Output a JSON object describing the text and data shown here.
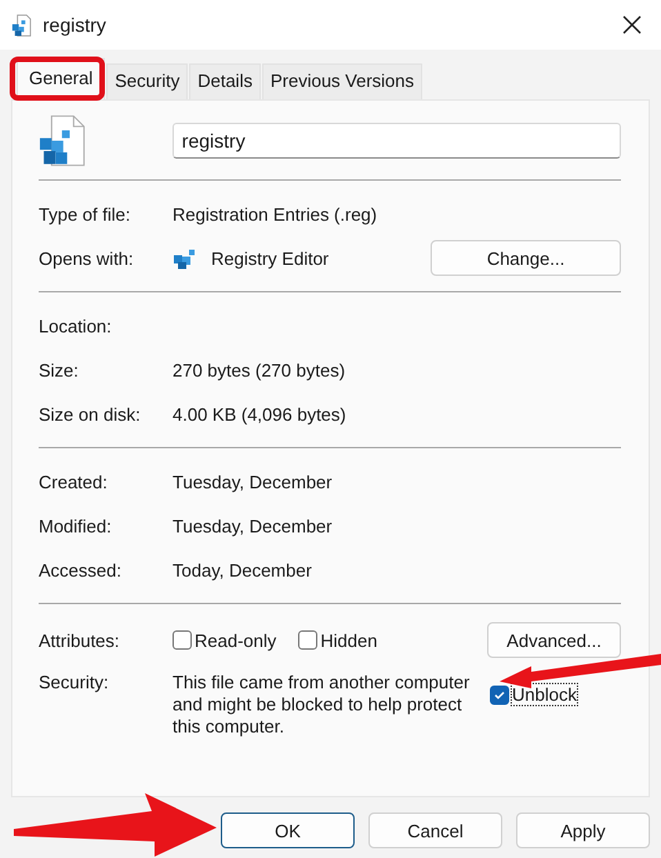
{
  "window": {
    "title": "registry"
  },
  "tabs": [
    {
      "label": "General",
      "selected": true
    },
    {
      "label": "Security",
      "selected": false
    },
    {
      "label": "Details",
      "selected": false
    },
    {
      "label": "Previous Versions",
      "selected": false
    }
  ],
  "file_name": {
    "value": "registry"
  },
  "opens": [
    {
      "label": "Type of file:",
      "value": "Registration Entries (.reg)"
    },
    {
      "label": "Opens with:",
      "value": "Registry Editor",
      "button": "Change..."
    }
  ],
  "location_rows": [
    {
      "label": "Location:"
    },
    {
      "label": "Size:",
      "value": "270 bytes (270 bytes)"
    },
    {
      "label": "Size on disk:",
      "value": "4.00 KB (4,096 bytes)"
    }
  ],
  "date_rows": [
    {
      "label": "Created:",
      "value": "Tuesday, December"
    },
    {
      "label": "Modified:",
      "value": "Tuesday, December"
    },
    {
      "label": "Accessed:",
      "value": "Today, December"
    }
  ],
  "attributes": {
    "label": "Attributes:",
    "checkboxes": [
      {
        "label": "Read-only",
        "checked": false
      },
      {
        "label": "Hidden",
        "checked": false
      }
    ],
    "button": "Advanced..."
  },
  "security": {
    "label": "Security:",
    "text": "This file came from another computer and might be blocked to help protect this computer.",
    "checkbox": {
      "label": "Unblock",
      "checked": true
    }
  },
  "buttons": [
    {
      "label": "OK",
      "default": true
    },
    {
      "label": "Cancel",
      "default": false
    },
    {
      "label": "Apply",
      "default": false
    }
  ]
}
